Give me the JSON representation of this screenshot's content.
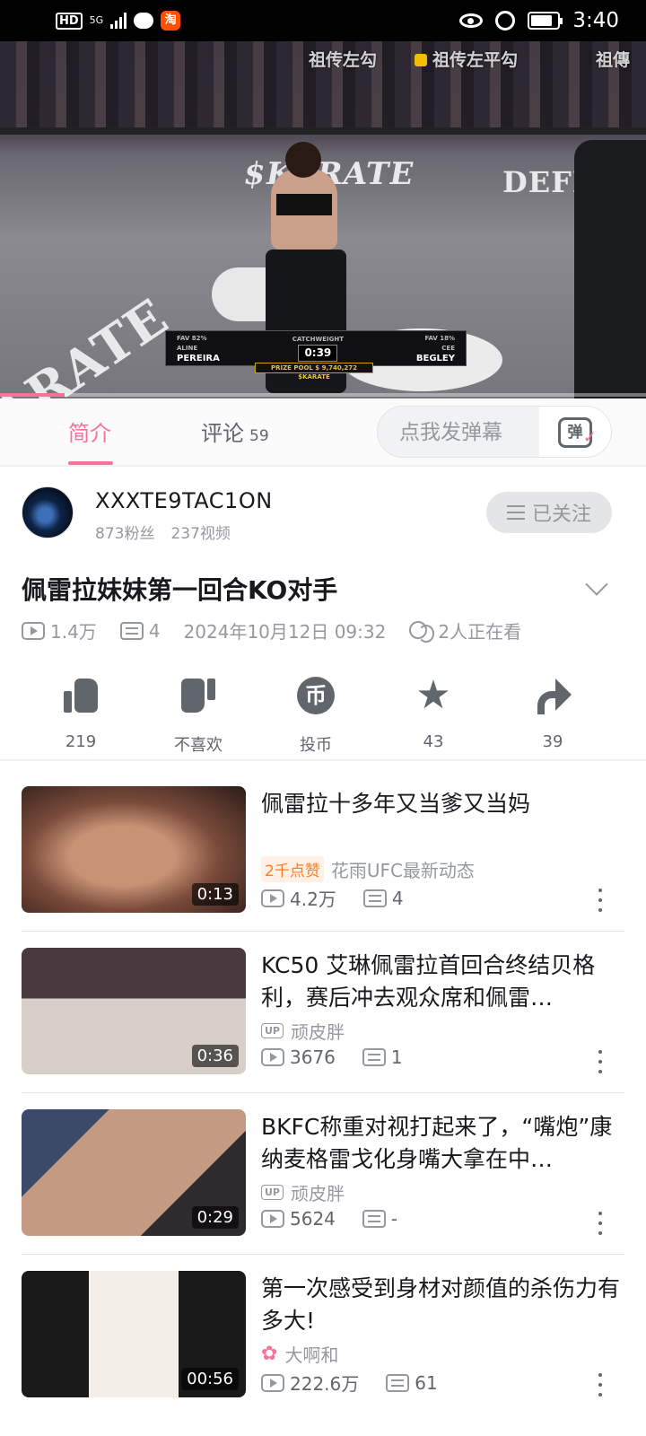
{
  "status_bar": {
    "hd": "HD",
    "network": "5G",
    "taobao": "淘",
    "time": "3:40",
    "battery_level": 0.8
  },
  "video": {
    "danmaku": [
      "祖传左勾",
      "祖传左平勾",
      "祖傳"
    ],
    "mat_brand": "$KARATE",
    "mat_sponsor": "DEFI KI",
    "mat_side": "ARATE",
    "scoreboard": {
      "left_name": "PEREIRA",
      "left_first": "ALINE",
      "left_fav": "FAV 82%",
      "weight_class": "CATCHWEIGHT",
      "timer": "0:39",
      "right_name": "BEGLEY",
      "right_first": "CEE",
      "right_fav": "FAV 18%",
      "prize": "PRIZE POOL $ 9,740,272 $KARATE"
    },
    "progress": 0.1
  },
  "tabs": {
    "intro": "简介",
    "comments": "评论",
    "comments_count": "59",
    "danmaku_placeholder": "点我发弹幕",
    "danmaku_toggle": "弹"
  },
  "uploader": {
    "name": "XXXTE9TAC1ON",
    "fans": "873粉丝",
    "videos": "237视频",
    "follow_label": "已关注"
  },
  "video_info": {
    "title": "佩雷拉妹妹第一回合KO对手",
    "views": "1.4万",
    "danmaku_count": "4",
    "date": "2024年10月12日 09:32",
    "watching": "2人正在看"
  },
  "actions": {
    "like": "219",
    "dislike": "不喜欢",
    "coin": "投币",
    "coin_glyph": "币",
    "favorite": "43",
    "share": "39"
  },
  "recommended": [
    {
      "title": "佩雷拉十多年又当爹又当妈",
      "duration": "0:13",
      "hot_tag": "2千点赞",
      "author": "花雨UFC最新动态",
      "author_badge": "",
      "views": "4.2万",
      "danmaku": "4"
    },
    {
      "title": "KC50  艾琳佩雷拉首回合终结贝格利，赛后冲去观众席和佩雷…",
      "duration": "0:36",
      "hot_tag": "",
      "author": "顽皮胖",
      "author_badge": "UP",
      "views": "3676",
      "danmaku": "1"
    },
    {
      "title": "BKFC称重对视打起来了，“嘴炮”康纳麦格雷戈化身嘴大拿在中…",
      "duration": "0:29",
      "hot_tag": "",
      "author": "顽皮胖",
      "author_badge": "UP",
      "views": "5624",
      "danmaku": "-"
    },
    {
      "title": "第一次感受到身材对颜值的杀伤力有多大!",
      "duration": "00:56",
      "hot_tag": "",
      "author": "大啊和",
      "author_badge": "",
      "views": "222.6万",
      "danmaku": "61"
    }
  ]
}
